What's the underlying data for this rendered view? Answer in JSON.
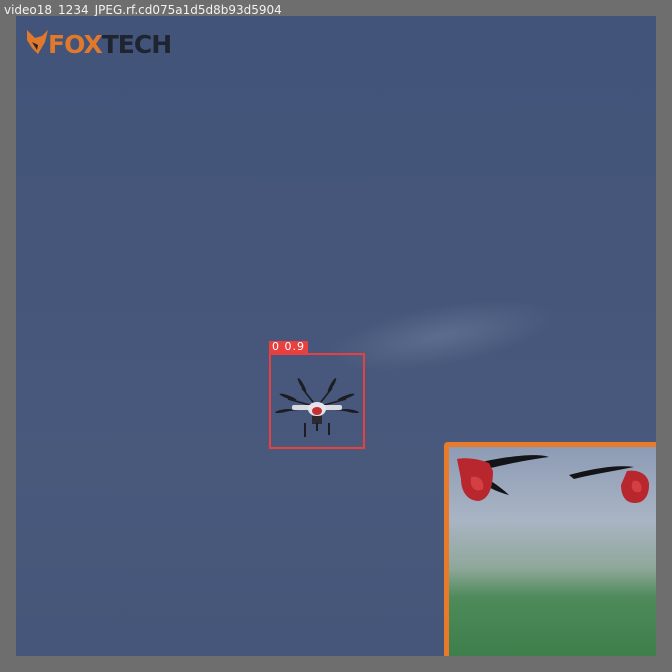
{
  "window": {
    "filename": "video18_1234_JPEG.rf.cd075a1d5d8b93d5904"
  },
  "logo": {
    "brand_fox": "FOX",
    "brand_tech": "TECH",
    "accent_color": "#e0792c"
  },
  "detection": {
    "label": "0 0.9",
    "box_color": "#e8403f",
    "object": "drone-icon"
  },
  "inset": {
    "border_color": "#e87a2a",
    "content": "propeller-closeup-image"
  },
  "colors": {
    "sky": "#45567a",
    "frame": "#6e6e6e"
  }
}
